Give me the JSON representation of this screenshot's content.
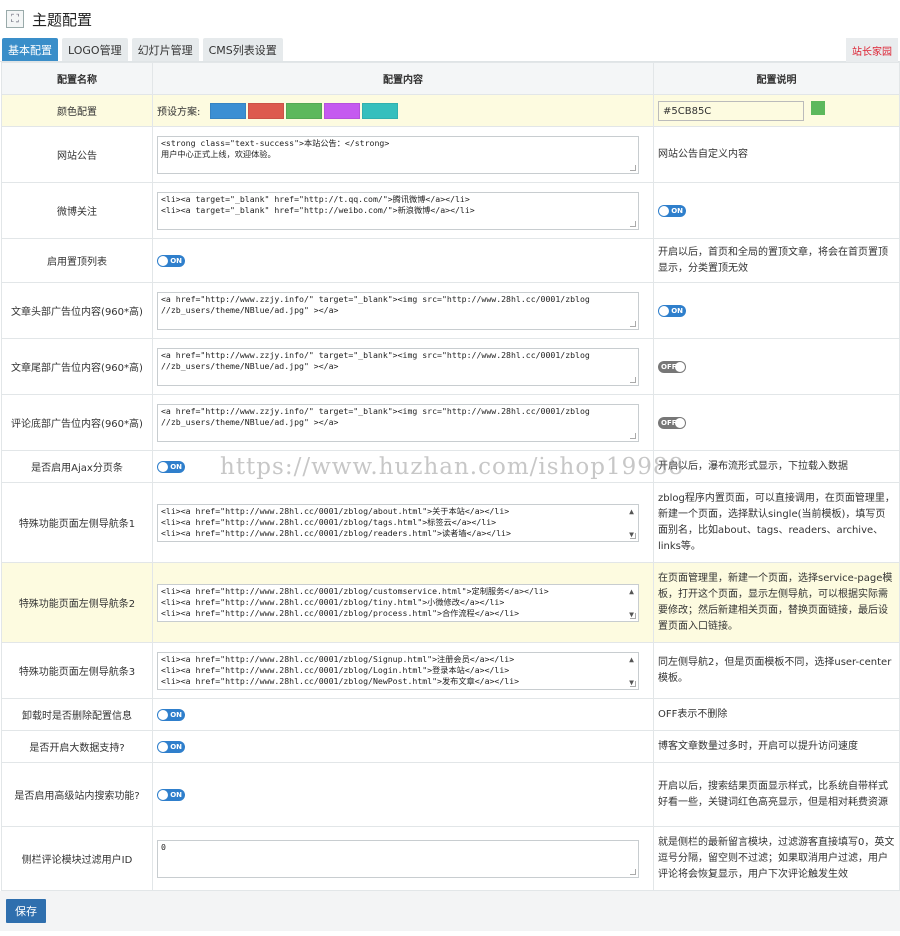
{
  "header": {
    "title": "主题配置"
  },
  "tabs": [
    "基本配置",
    "LOGO管理",
    "幻灯片管理",
    "CMS列表设置"
  ],
  "site_link": "站长家园",
  "table_headers": {
    "name": "配置名称",
    "content": "配置内容",
    "desc": "配置说明"
  },
  "colors": {
    "swatches": [
      "#3b8fd3",
      "#dd5a4e",
      "#5cb85c",
      "#c55af0",
      "#36bfbd"
    ],
    "preview": "#5CB85C"
  },
  "rows": {
    "color": {
      "name": "颜色配置",
      "preset_label": "预设方案:",
      "input_value": "#5CB85C"
    },
    "notice": {
      "name": "网站公告",
      "value": "<strong class=\"text-success\">本站公告：</strong>\n用户中心正式上线，欢迎体验。",
      "desc": "网站公告自定义内容"
    },
    "weibo": {
      "name": "微博关注",
      "value": "<li><a target=\"_blank\" href=\"http://t.qq.com/\">腾讯微博</a></li>\n<li><a target=\"_blank\" href=\"http://weibo.com/\">新浪微博</a></li>",
      "toggle": "ON"
    },
    "sticky": {
      "name": "启用置顶列表",
      "toggle": "ON",
      "desc": "开启以后，首页和全局的置顶文章，将会在首页置顶显示，分类置顶无效"
    },
    "ad_head": {
      "name": "文章头部广告位内容(960*高)",
      "value": "<a href=\"http://www.zzjy.info/\" target=\"_blank\"><img src=\"http://www.28hl.cc/0001/zblog\n//zb_users/theme/NBlue/ad.jpg\" ></a>",
      "toggle": "ON"
    },
    "ad_foot": {
      "name": "文章尾部广告位内容(960*高)",
      "value": "<a href=\"http://www.zzjy.info/\" target=\"_blank\"><img src=\"http://www.28hl.cc/0001/zblog\n//zb_users/theme/NBlue/ad.jpg\" ></a>",
      "toggle": "OFF"
    },
    "ad_comment": {
      "name": "评论底部广告位内容(960*高)",
      "value": "<a href=\"http://www.zzjy.info/\" target=\"_blank\"><img src=\"http://www.28hl.cc/0001/zblog\n//zb_users/theme/NBlue/ad.jpg\" ></a>",
      "toggle": "OFF"
    },
    "ajax": {
      "name": "是否启用Ajax分页条",
      "toggle": "ON",
      "desc": "开启以后，瀑布流形式显示，下拉载入数据"
    },
    "nav1": {
      "name": "特殊功能页面左侧导航条1",
      "value": "<li><a href=\"http://www.28hl.cc/0001/zblog/about.html\">关于本站</a></li>\n<li><a href=\"http://www.28hl.cc/0001/zblog/tags.html\">标签云</a></li>\n<li><a href=\"http://www.28hl.cc/0001/zblog/readers.html\">读者墙</a></li>",
      "desc": "zblog程序内置页面，可以直接调用，在页面管理里，新建一个页面，选择默认single(当前模板)，填写页面别名，比如about、tags、readers、archive、links等。"
    },
    "nav2": {
      "name": "特殊功能页面左侧导航条2",
      "value": "<li><a href=\"http://www.28hl.cc/0001/zblog/customservice.html\">定制服务</a></li>\n<li><a href=\"http://www.28hl.cc/0001/zblog/tiny.html\">小微修改</a></li>\n<li><a href=\"http://www.28hl.cc/0001/zblog/process.html\">合作流程</a></li>",
      "desc": "在页面管理里，新建一个页面，选择service-page模板，打开这个页面，显示左侧导航，可以根据实际需要修改；然后新建相关页面，替换页面链接，最后设置页面入口链接。"
    },
    "nav3": {
      "name": "特殊功能页面左侧导航条3",
      "value": "<li><a href=\"http://www.28hl.cc/0001/zblog/Signup.html\">注册会员</a></li>\n<li><a href=\"http://www.28hl.cc/0001/zblog/Login.html\">登录本站</a></li>\n<li><a href=\"http://www.28hl.cc/0001/zblog/NewPost.html\">发布文章</a></li>",
      "desc": "同左侧导航2，但是页面模板不同，选择user-center模板。"
    },
    "uninstall": {
      "name": "卸载时是否删除配置信息",
      "toggle": "ON",
      "desc": "OFF表示不删除"
    },
    "bigdata": {
      "name": "是否开启大数据支持?",
      "toggle": "ON",
      "desc": "博客文章数量过多时，开启可以提升访问速度"
    },
    "search": {
      "name": "是否启用高级站内搜索功能?",
      "toggle": "ON",
      "desc": "开启以后，搜索结果页面显示样式，比系统自带样式好看一些，关键词红色高亮显示，但是相对耗费资源"
    },
    "comment_filter": {
      "name": "侧栏评论模块过滤用户ID",
      "value": "0",
      "desc": "就是侧栏的最新留言模块，过滤游客直接填写0，英文逗号分隔，留空则不过滤；如果取消用户过滤，用户评论将会恢复显示，用户下次评论触发生效"
    }
  },
  "save_label": "保存",
  "watermark": "https://www.huzhan.com/ishop19988"
}
